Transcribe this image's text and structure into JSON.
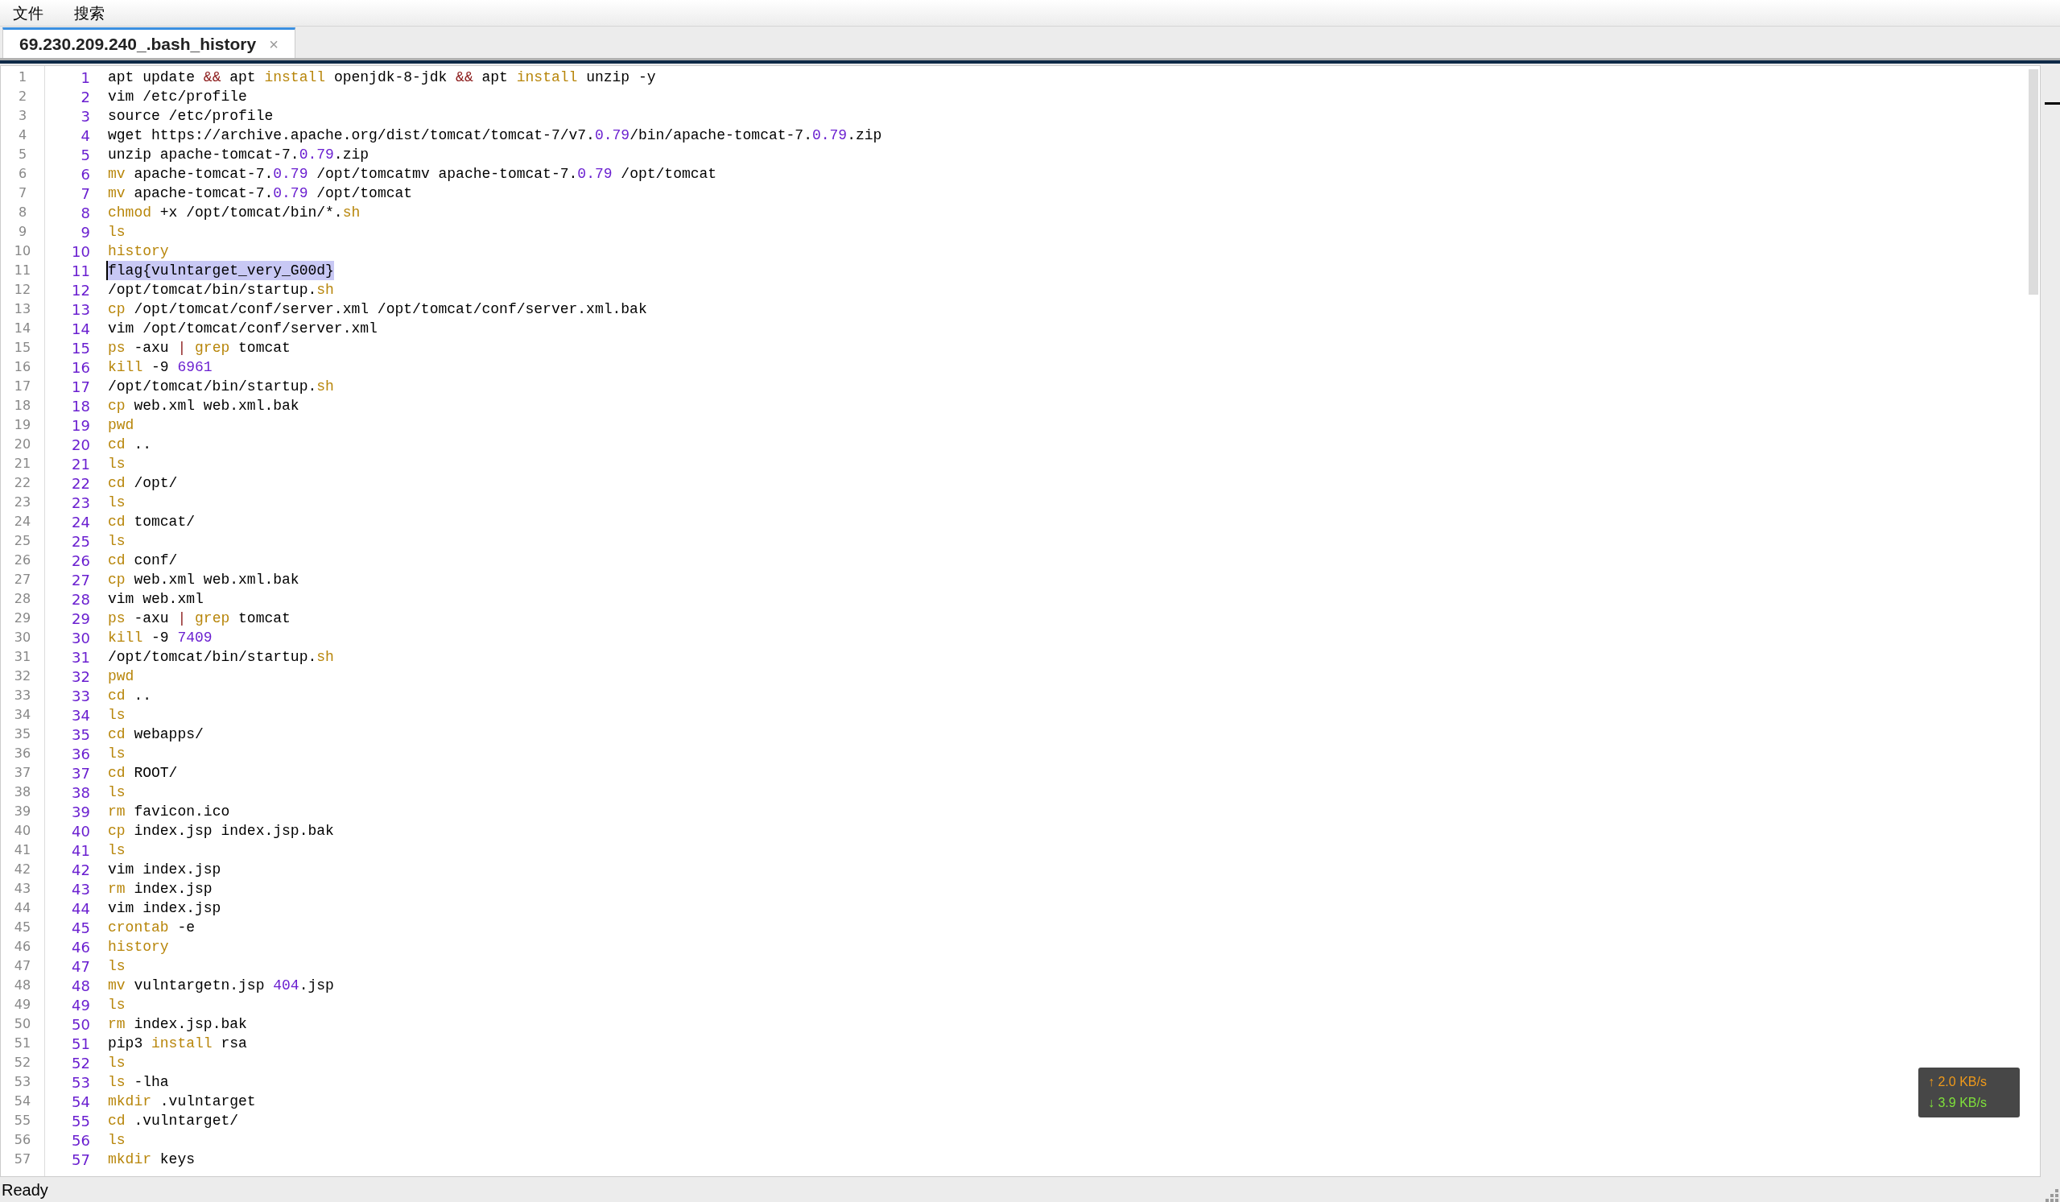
{
  "menu": [
    {
      "label": "文件"
    },
    {
      "label": "搜索"
    }
  ],
  "tabs": [
    {
      "label": "69.230.209.240_.bash_history",
      "close": "×",
      "selected": true
    }
  ],
  "lines": [
    {
      "index": "1",
      "number": "1",
      "selected": false,
      "tokens": [
        {
          "kind": "plain",
          "text": "apt update "
        },
        {
          "kind": "operator",
          "text": "&&"
        },
        {
          "kind": "plain",
          "text": " apt "
        },
        {
          "kind": "keyword",
          "text": "install"
        },
        {
          "kind": "plain",
          "text": " openjdk-8-jdk "
        },
        {
          "kind": "operator",
          "text": "&&"
        },
        {
          "kind": "plain",
          "text": " apt "
        },
        {
          "kind": "keyword",
          "text": "install"
        },
        {
          "kind": "plain",
          "text": " unzip -y"
        }
      ]
    },
    {
      "index": "2",
      "number": "2",
      "selected": false,
      "tokens": [
        {
          "kind": "plain",
          "text": "vim /etc/profile"
        }
      ]
    },
    {
      "index": "3",
      "number": "3",
      "selected": false,
      "tokens": [
        {
          "kind": "plain",
          "text": "source /etc/profile"
        }
      ]
    },
    {
      "index": "4",
      "number": "4",
      "selected": false,
      "tokens": [
        {
          "kind": "plain",
          "text": "wget https://archive.apache.org/dist/tomcat/tomcat-7/v7."
        },
        {
          "kind": "number",
          "text": "0.79"
        },
        {
          "kind": "plain",
          "text": "/bin/apache-tomcat-7."
        },
        {
          "kind": "number",
          "text": "0.79"
        },
        {
          "kind": "plain",
          "text": ".zip"
        }
      ]
    },
    {
      "index": "5",
      "number": "5",
      "selected": false,
      "tokens": [
        {
          "kind": "plain",
          "text": "unzip apache-tomcat-7."
        },
        {
          "kind": "number",
          "text": "0.79"
        },
        {
          "kind": "plain",
          "text": ".zip"
        }
      ]
    },
    {
      "index": "6",
      "number": "6",
      "selected": false,
      "tokens": [
        {
          "kind": "keyword",
          "text": "mv"
        },
        {
          "kind": "plain",
          "text": " apache-tomcat-7."
        },
        {
          "kind": "number",
          "text": "0.79"
        },
        {
          "kind": "plain",
          "text": " /opt/tomcatmv apache-tomcat-7."
        },
        {
          "kind": "number",
          "text": "0.79"
        },
        {
          "kind": "plain",
          "text": " /opt/tomcat"
        }
      ]
    },
    {
      "index": "7",
      "number": "7",
      "selected": false,
      "tokens": [
        {
          "kind": "keyword",
          "text": "mv"
        },
        {
          "kind": "plain",
          "text": " apache-tomcat-7."
        },
        {
          "kind": "number",
          "text": "0.79"
        },
        {
          "kind": "plain",
          "text": " /opt/tomcat"
        }
      ]
    },
    {
      "index": "8",
      "number": "8",
      "selected": false,
      "tokens": [
        {
          "kind": "keyword",
          "text": "chmod"
        },
        {
          "kind": "plain",
          "text": " +x /opt/tomcat/bin/*."
        },
        {
          "kind": "keyword",
          "text": "sh"
        }
      ]
    },
    {
      "index": "9",
      "number": "9",
      "selected": false,
      "tokens": [
        {
          "kind": "keyword",
          "text": "ls"
        }
      ]
    },
    {
      "index": "10",
      "number": "10",
      "selected": false,
      "tokens": [
        {
          "kind": "keyword",
          "text": "history"
        }
      ]
    },
    {
      "index": "11",
      "number": "11",
      "selected": true,
      "tokens": [
        {
          "kind": "plain",
          "text": "flag{vulntarget_very_G00d}"
        }
      ]
    },
    {
      "index": "12",
      "number": "12",
      "selected": false,
      "tokens": [
        {
          "kind": "plain",
          "text": "/opt/tomcat/bin/startup."
        },
        {
          "kind": "keyword",
          "text": "sh"
        }
      ]
    },
    {
      "index": "13",
      "number": "13",
      "selected": false,
      "tokens": [
        {
          "kind": "keyword",
          "text": "cp"
        },
        {
          "kind": "plain",
          "text": " /opt/tomcat/conf/server.xml /opt/tomcat/conf/server.xml.bak"
        }
      ]
    },
    {
      "index": "14",
      "number": "14",
      "selected": false,
      "tokens": [
        {
          "kind": "plain",
          "text": "vim /opt/tomcat/conf/server.xml"
        }
      ]
    },
    {
      "index": "15",
      "number": "15",
      "selected": false,
      "tokens": [
        {
          "kind": "keyword",
          "text": "ps"
        },
        {
          "kind": "plain",
          "text": " -axu "
        },
        {
          "kind": "operator",
          "text": "| "
        },
        {
          "kind": "keyword",
          "text": "grep"
        },
        {
          "kind": "plain",
          "text": " tomcat"
        }
      ]
    },
    {
      "index": "16",
      "number": "16",
      "selected": false,
      "tokens": [
        {
          "kind": "keyword",
          "text": "kill"
        },
        {
          "kind": "plain",
          "text": " -9 "
        },
        {
          "kind": "number",
          "text": "6961"
        }
      ]
    },
    {
      "index": "17",
      "number": "17",
      "selected": false,
      "tokens": [
        {
          "kind": "plain",
          "text": "/opt/tomcat/bin/startup."
        },
        {
          "kind": "keyword",
          "text": "sh"
        }
      ]
    },
    {
      "index": "18",
      "number": "18",
      "selected": false,
      "tokens": [
        {
          "kind": "keyword",
          "text": "cp"
        },
        {
          "kind": "plain",
          "text": " web.xml web.xml.bak"
        }
      ]
    },
    {
      "index": "19",
      "number": "19",
      "selected": false,
      "tokens": [
        {
          "kind": "keyword",
          "text": "pwd"
        }
      ]
    },
    {
      "index": "20",
      "number": "20",
      "selected": false,
      "tokens": [
        {
          "kind": "keyword",
          "text": "cd"
        },
        {
          "kind": "plain",
          "text": " .."
        }
      ]
    },
    {
      "index": "21",
      "number": "21",
      "selected": false,
      "tokens": [
        {
          "kind": "keyword",
          "text": "ls"
        }
      ]
    },
    {
      "index": "22",
      "number": "22",
      "selected": false,
      "tokens": [
        {
          "kind": "keyword",
          "text": "cd"
        },
        {
          "kind": "plain",
          "text": " /opt/"
        }
      ]
    },
    {
      "index": "23",
      "number": "23",
      "selected": false,
      "tokens": [
        {
          "kind": "keyword",
          "text": "ls"
        }
      ]
    },
    {
      "index": "24",
      "number": "24",
      "selected": false,
      "tokens": [
        {
          "kind": "keyword",
          "text": "cd"
        },
        {
          "kind": "plain",
          "text": " tomcat/"
        }
      ]
    },
    {
      "index": "25",
      "number": "25",
      "selected": false,
      "tokens": [
        {
          "kind": "keyword",
          "text": "ls"
        }
      ]
    },
    {
      "index": "26",
      "number": "26",
      "selected": false,
      "tokens": [
        {
          "kind": "keyword",
          "text": "cd"
        },
        {
          "kind": "plain",
          "text": " conf/"
        }
      ]
    },
    {
      "index": "27",
      "number": "27",
      "selected": false,
      "tokens": [
        {
          "kind": "keyword",
          "text": "cp"
        },
        {
          "kind": "plain",
          "text": " web.xml web.xml.bak"
        }
      ]
    },
    {
      "index": "28",
      "number": "28",
      "selected": false,
      "tokens": [
        {
          "kind": "plain",
          "text": "vim web.xml"
        }
      ]
    },
    {
      "index": "29",
      "number": "29",
      "selected": false,
      "tokens": [
        {
          "kind": "keyword",
          "text": "ps"
        },
        {
          "kind": "plain",
          "text": " -axu "
        },
        {
          "kind": "operator",
          "text": "| "
        },
        {
          "kind": "keyword",
          "text": "grep"
        },
        {
          "kind": "plain",
          "text": " tomcat"
        }
      ]
    },
    {
      "index": "30",
      "number": "30",
      "selected": false,
      "tokens": [
        {
          "kind": "keyword",
          "text": "kill"
        },
        {
          "kind": "plain",
          "text": " -9 "
        },
        {
          "kind": "number",
          "text": "7409"
        }
      ]
    },
    {
      "index": "31",
      "number": "31",
      "selected": false,
      "tokens": [
        {
          "kind": "plain",
          "text": "/opt/tomcat/bin/startup."
        },
        {
          "kind": "keyword",
          "text": "sh"
        }
      ]
    },
    {
      "index": "32",
      "number": "32",
      "selected": false,
      "tokens": [
        {
          "kind": "keyword",
          "text": "pwd"
        }
      ]
    },
    {
      "index": "33",
      "number": "33",
      "selected": false,
      "tokens": [
        {
          "kind": "keyword",
          "text": "cd"
        },
        {
          "kind": "plain",
          "text": " .."
        }
      ]
    },
    {
      "index": "34",
      "number": "34",
      "selected": false,
      "tokens": [
        {
          "kind": "keyword",
          "text": "ls"
        }
      ]
    },
    {
      "index": "35",
      "number": "35",
      "selected": false,
      "tokens": [
        {
          "kind": "keyword",
          "text": "cd"
        },
        {
          "kind": "plain",
          "text": " webapps/"
        }
      ]
    },
    {
      "index": "36",
      "number": "36",
      "selected": false,
      "tokens": [
        {
          "kind": "keyword",
          "text": "ls"
        }
      ]
    },
    {
      "index": "37",
      "number": "37",
      "selected": false,
      "tokens": [
        {
          "kind": "keyword",
          "text": "cd"
        },
        {
          "kind": "plain",
          "text": " ROOT/"
        }
      ]
    },
    {
      "index": "38",
      "number": "38",
      "selected": false,
      "tokens": [
        {
          "kind": "keyword",
          "text": "ls"
        }
      ]
    },
    {
      "index": "39",
      "number": "39",
      "selected": false,
      "tokens": [
        {
          "kind": "keyword",
          "text": "rm"
        },
        {
          "kind": "plain",
          "text": " favicon.ico"
        }
      ]
    },
    {
      "index": "40",
      "number": "40",
      "selected": false,
      "tokens": [
        {
          "kind": "keyword",
          "text": "cp"
        },
        {
          "kind": "plain",
          "text": " index.jsp index.jsp.bak"
        }
      ]
    },
    {
      "index": "41",
      "number": "41",
      "selected": false,
      "tokens": [
        {
          "kind": "keyword",
          "text": "ls"
        }
      ]
    },
    {
      "index": "42",
      "number": "42",
      "selected": false,
      "tokens": [
        {
          "kind": "plain",
          "text": "vim index.jsp"
        }
      ]
    },
    {
      "index": "43",
      "number": "43",
      "selected": false,
      "tokens": [
        {
          "kind": "keyword",
          "text": "rm"
        },
        {
          "kind": "plain",
          "text": " index.jsp"
        }
      ]
    },
    {
      "index": "44",
      "number": "44",
      "selected": false,
      "tokens": [
        {
          "kind": "plain",
          "text": "vim index.jsp"
        }
      ]
    },
    {
      "index": "45",
      "number": "45",
      "selected": false,
      "tokens": [
        {
          "kind": "keyword",
          "text": "crontab"
        },
        {
          "kind": "plain",
          "text": " -e"
        }
      ]
    },
    {
      "index": "46",
      "number": "46",
      "selected": false,
      "tokens": [
        {
          "kind": "keyword",
          "text": "history"
        }
      ]
    },
    {
      "index": "47",
      "number": "47",
      "selected": false,
      "tokens": [
        {
          "kind": "keyword",
          "text": "ls"
        }
      ]
    },
    {
      "index": "48",
      "number": "48",
      "selected": false,
      "tokens": [
        {
          "kind": "keyword",
          "text": "mv"
        },
        {
          "kind": "plain",
          "text": " vulntargetn.jsp "
        },
        {
          "kind": "number",
          "text": "404"
        },
        {
          "kind": "plain",
          "text": ".jsp"
        }
      ]
    },
    {
      "index": "49",
      "number": "49",
      "selected": false,
      "tokens": [
        {
          "kind": "keyword",
          "text": "ls"
        }
      ]
    },
    {
      "index": "50",
      "number": "50",
      "selected": false,
      "tokens": [
        {
          "kind": "keyword",
          "text": "rm"
        },
        {
          "kind": "plain",
          "text": " index.jsp.bak"
        }
      ]
    },
    {
      "index": "51",
      "number": "51",
      "selected": false,
      "tokens": [
        {
          "kind": "plain",
          "text": "pip3 "
        },
        {
          "kind": "keyword",
          "text": "install"
        },
        {
          "kind": "plain",
          "text": " rsa"
        }
      ]
    },
    {
      "index": "52",
      "number": "52",
      "selected": false,
      "tokens": [
        {
          "kind": "keyword",
          "text": "ls"
        }
      ]
    },
    {
      "index": "53",
      "number": "53",
      "selected": false,
      "tokens": [
        {
          "kind": "keyword",
          "text": "ls"
        },
        {
          "kind": "plain",
          "text": " -lha"
        }
      ]
    },
    {
      "index": "54",
      "number": "54",
      "selected": false,
      "tokens": [
        {
          "kind": "keyword",
          "text": "mkdir"
        },
        {
          "kind": "plain",
          "text": " .vulntarget"
        }
      ]
    },
    {
      "index": "55",
      "number": "55",
      "selected": false,
      "tokens": [
        {
          "kind": "keyword",
          "text": "cd"
        },
        {
          "kind": "plain",
          "text": " .vulntarget/"
        }
      ]
    },
    {
      "index": "56",
      "number": "56",
      "selected": false,
      "tokens": [
        {
          "kind": "keyword",
          "text": "ls"
        }
      ]
    },
    {
      "index": "57",
      "number": "57",
      "selected": false,
      "tokens": [
        {
          "kind": "keyword",
          "text": "mkdir"
        },
        {
          "kind": "plain",
          "text": " keys"
        }
      ]
    }
  ],
  "network_speed": [
    {
      "kind": "up",
      "arrow": "↑",
      "text": "2.0 KB/s"
    },
    {
      "kind": "down",
      "arrow": "↓",
      "text": "3.9 KB/s"
    }
  ],
  "status_bar": {
    "text": "Ready"
  }
}
